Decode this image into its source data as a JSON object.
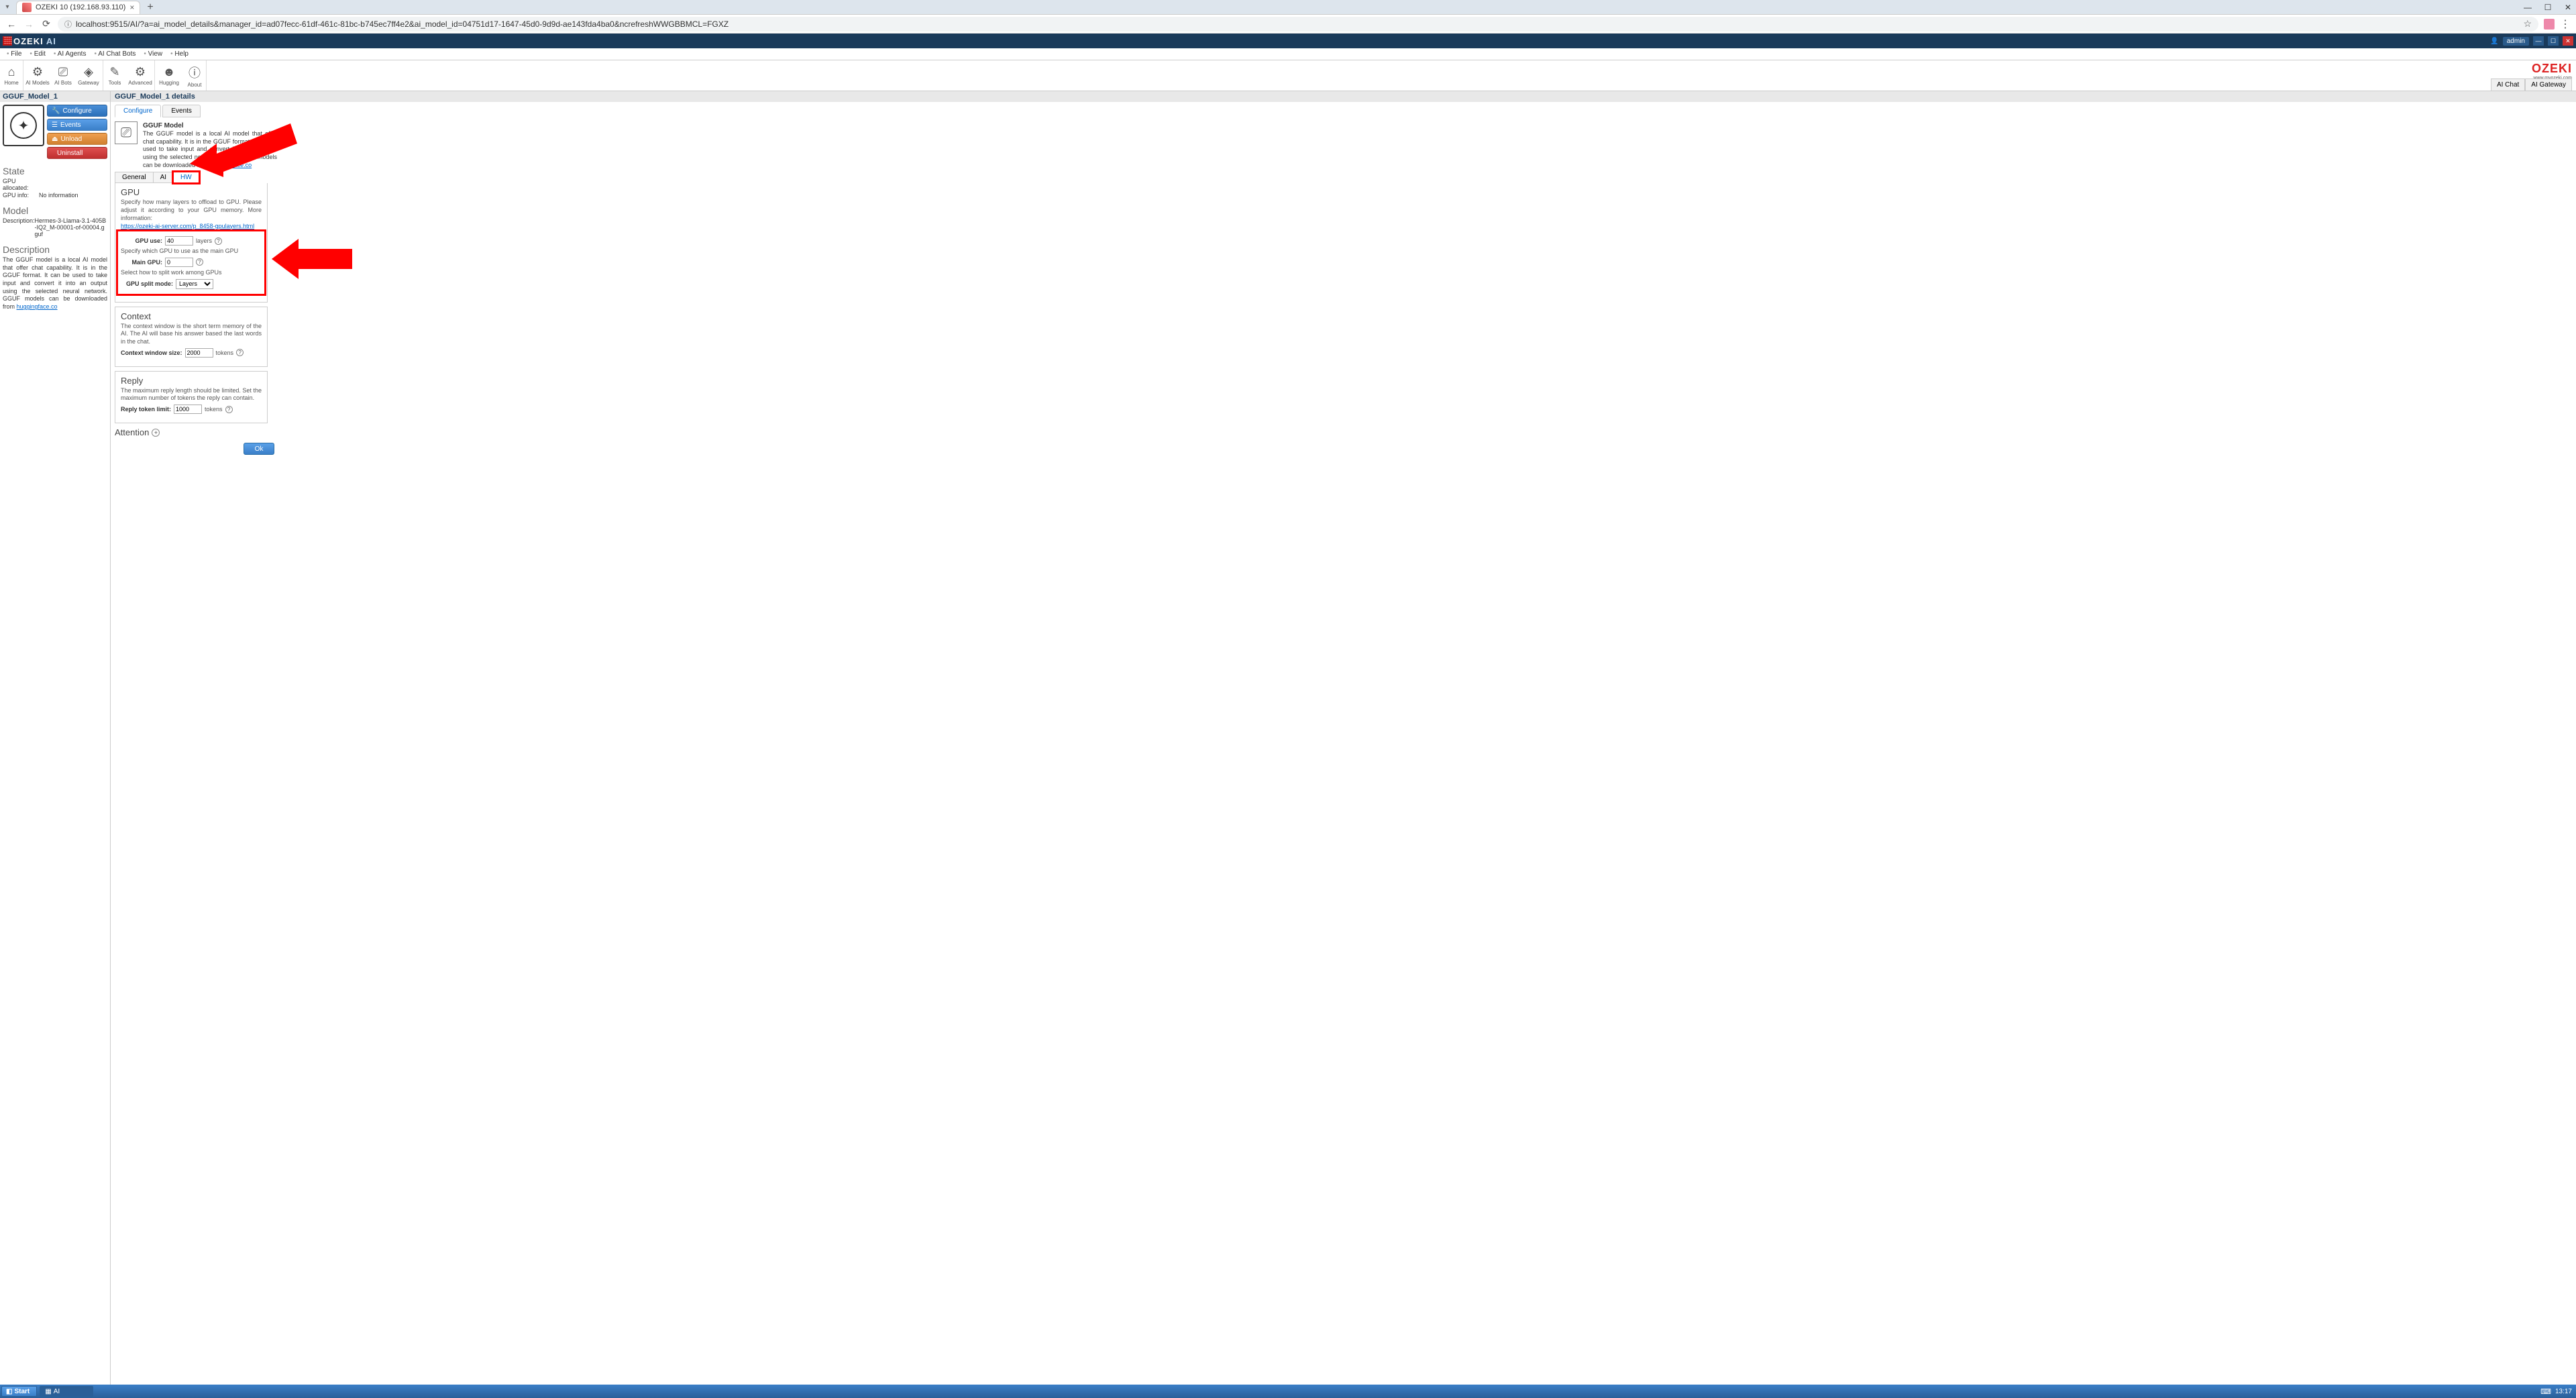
{
  "browser": {
    "tab_title": "OZEKI 10 (192.168.93.110)",
    "url": "localhost:9515/AI/?a=ai_model_details&manager_id=ad07fecc-61df-461c-81bc-b745ec7ff4e2&ai_model_id=04751d17-1647-45d0-9d9d-ae143fda4ba0&ncrefreshWWGBBMCL=FGXZ",
    "win_min": "—",
    "win_max": "☐",
    "win_close": "✕"
  },
  "app_header": {
    "logo1": "OZEKI",
    "logo2": "AI",
    "user": "admin",
    "min": "—",
    "max": "☐",
    "close": "✕"
  },
  "menus": [
    "File",
    "Edit",
    "AI Agents",
    "AI Chat Bots",
    "View",
    "Help"
  ],
  "toolbar": [
    {
      "icon": "⌂",
      "label": "Home"
    },
    {
      "icon": "⚙",
      "label": "AI Models"
    },
    {
      "icon": "⎚",
      "label": "AI Bots"
    },
    {
      "icon": "◈",
      "label": "Gateway"
    },
    {
      "icon": "✎",
      "label": "Tools"
    },
    {
      "icon": "⚙",
      "label": "Advanced"
    },
    {
      "icon": "☻",
      "label": "Hugging"
    },
    {
      "icon": "ⓘ",
      "label": "About"
    }
  ],
  "brand": {
    "name": "OZEKI",
    "url": "www.myozeki.com"
  },
  "subtabs_right": [
    "AI Chat",
    "AI Gateway"
  ],
  "left": {
    "title": "GGUF_Model_1",
    "buttons": {
      "configure": "Configure",
      "events": "Events",
      "unload": "Unload",
      "uninstall": "Uninstall"
    },
    "state_title": "State",
    "state": [
      {
        "k": "GPU allocated:",
        "v": ""
      },
      {
        "k": "GPU info:",
        "v": "No information"
      }
    ],
    "model_title": "Model",
    "model_desc_k": "Description:",
    "model_desc_v": "Hermes-3-Llama-3.1-405B-IQ2_M-00001-of-00004.gguf",
    "desc_title": "Description",
    "desc_text": "The GGUF model is a local AI model that offer chat capability. It is in the GGUF format. It can be used to take input and convert it into an output using the selected neural network. GGUF models can be downloaded from ",
    "desc_link": "huggingface.co"
  },
  "content": {
    "title": "GGUF_Model_1 details",
    "tabs": [
      "Configure",
      "Events"
    ],
    "info_title": "GGUF Model",
    "info_text": "The GGUF model is a local AI model that offer chat capability. It is in the GGUF format. It can be used to take input and convert it into an output using the selected neural network. GGUF models can be downloaded from ",
    "info_link": "huggingface.co",
    "subtabs": [
      "General",
      "AI",
      "HW"
    ],
    "gpu": {
      "title": "GPU",
      "desc": "Specify how many layers to offload to GPU. Please adjust it according to your GPU memory. More information:",
      "link": "https://ozeki-ai-server.com/p_8458-gpulayers.html",
      "use_label": "GPU use:",
      "use_value": "40",
      "use_unit": "layers",
      "main_desc": "Specify which GPU to use as the main GPU",
      "main_label": "Main GPU:",
      "main_value": "0",
      "split_desc": "Select how to split work among GPUs",
      "split_label": "GPU split mode:",
      "split_value": "Layers"
    },
    "context": {
      "title": "Context",
      "desc": "The context window is the short term memory of the AI. The AI will base his answer based the last words in the chat.",
      "label": "Context window size:",
      "value": "2000",
      "unit": "tokens"
    },
    "reply": {
      "title": "Reply",
      "desc": "The maximum reply length should be limited. Set the maximum number of tokens the reply can contain.",
      "label": "Reply token limit:",
      "value": "1000",
      "unit": "tokens"
    },
    "attention": "Attention",
    "ok": "Ok"
  },
  "taskbar": {
    "start": "Start",
    "task": "AI",
    "time": "13:17"
  }
}
